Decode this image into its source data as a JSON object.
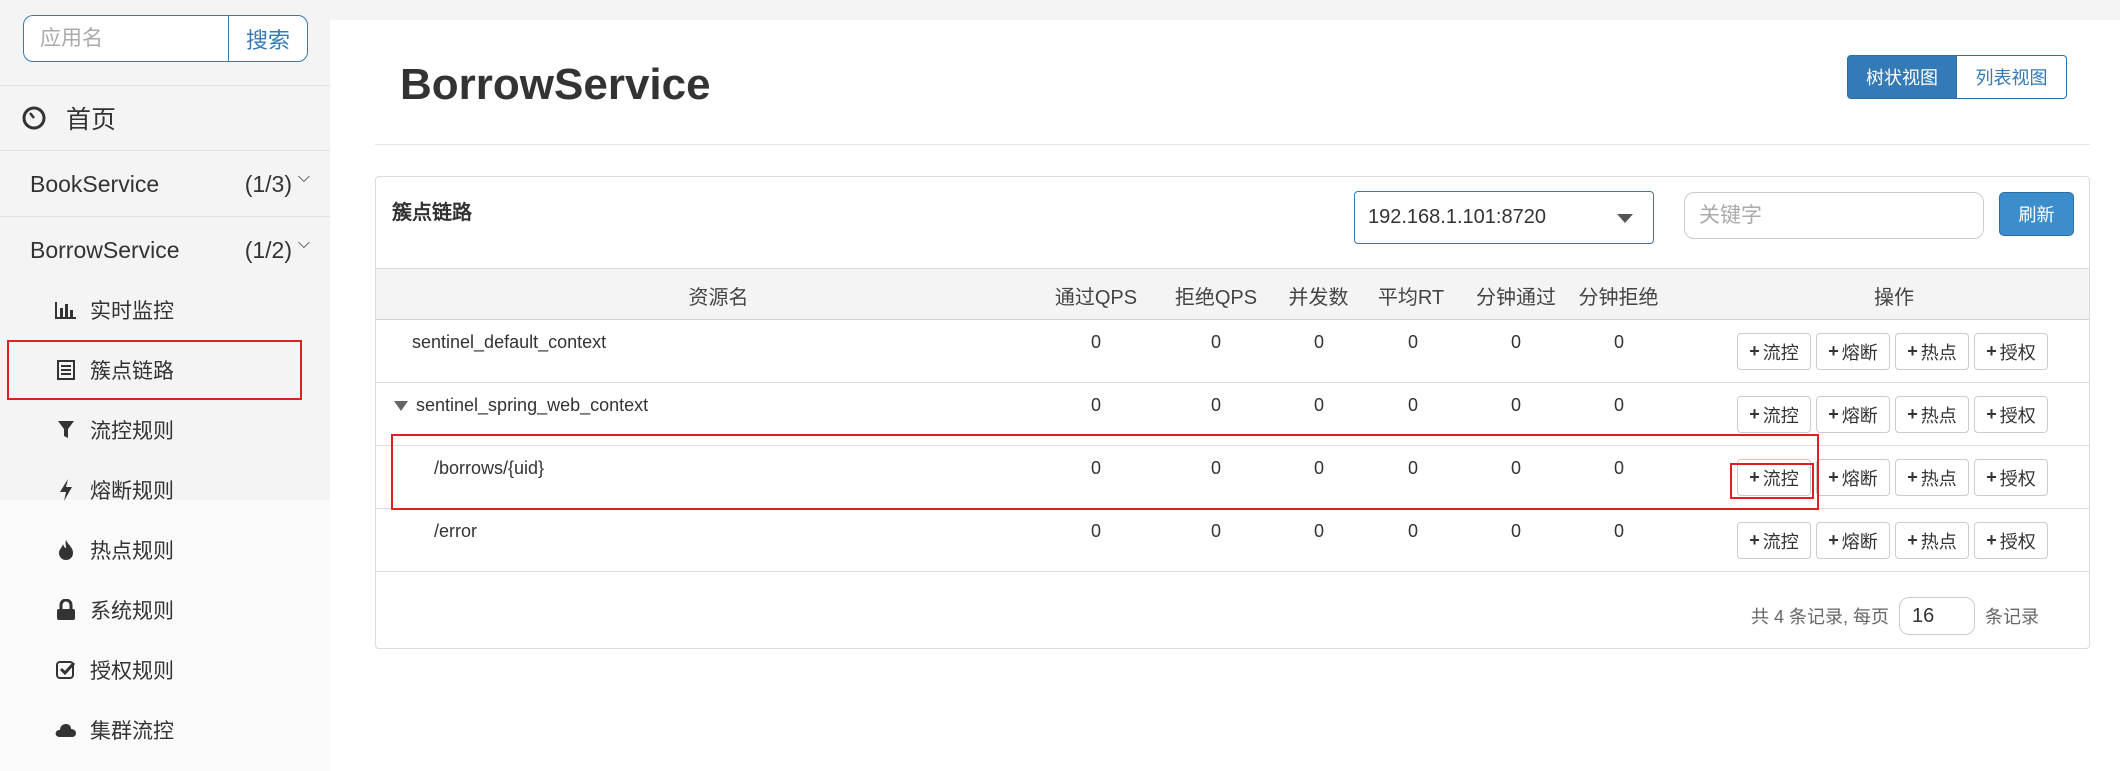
{
  "sidebar": {
    "search_placeholder": "应用名",
    "search_button": "搜索",
    "home_label": "首页",
    "apps": [
      {
        "name": "BookService",
        "count": "(1/3)"
      },
      {
        "name": "BorrowService",
        "count": "(1/2)"
      }
    ],
    "menu": [
      {
        "label": "实时监控",
        "icon": "bar-chart-icon"
      },
      {
        "label": "簇点链路",
        "icon": "list-icon"
      },
      {
        "label": "流控规则",
        "icon": "filter-icon"
      },
      {
        "label": "熔断规则",
        "icon": "bolt-icon"
      },
      {
        "label": "热点规则",
        "icon": "fire-icon"
      },
      {
        "label": "系统规则",
        "icon": "lock-icon"
      },
      {
        "label": "授权规则",
        "icon": "check-square-icon"
      },
      {
        "label": "集群流控",
        "icon": "cloud-icon"
      }
    ]
  },
  "main": {
    "title": "BorrowService",
    "view_tree": "树状视图",
    "view_list": "列表视图",
    "panel_title": "簇点链路",
    "machine_select": "192.168.1.101:8720",
    "keyword_placeholder": "关键字",
    "refresh": "刷新",
    "columns": [
      "资源名",
      "通过QPS",
      "拒绝QPS",
      "并发数",
      "平均RT",
      "分钟通过",
      "分钟拒绝",
      "操作"
    ],
    "rows": [
      {
        "name": "sentinel_default_context",
        "values": [
          "0",
          "0",
          "0",
          "0",
          "0",
          "0"
        ]
      },
      {
        "name": "sentinel_spring_web_context",
        "values": [
          "0",
          "0",
          "0",
          "0",
          "0",
          "0"
        ]
      },
      {
        "name": "/borrows/{uid}",
        "values": [
          "0",
          "0",
          "0",
          "0",
          "0",
          "0"
        ]
      },
      {
        "name": "/error",
        "values": [
          "0",
          "0",
          "0",
          "0",
          "0",
          "0"
        ]
      }
    ],
    "ops": [
      "流控",
      "熔断",
      "热点",
      "授权"
    ],
    "pager": {
      "prefix": "共 4 条记录, 每页",
      "page_size": "16",
      "suffix": "条记录"
    }
  },
  "colors": {
    "accent": "#337ab7",
    "highlight": "#e02020"
  }
}
